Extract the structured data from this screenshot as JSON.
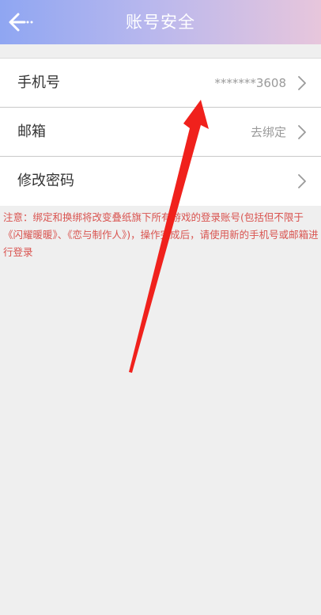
{
  "header": {
    "title": "账号安全",
    "back_icon": "arrow-left-icon"
  },
  "rows": [
    {
      "label": "手机号",
      "value": "*******3608",
      "icon": "chevron-right-icon"
    },
    {
      "label": "邮箱",
      "value": "去绑定",
      "icon": "chevron-right-icon"
    },
    {
      "label": "修改密码",
      "value": "",
      "icon": "chevron-right-icon"
    }
  ],
  "notice": "注意：绑定和换绑将改变叠纸旗下所有游戏的登录账号(包括但不限于《闪耀暖暖》、《恋与制作人》)，操作完成后，请使用新的手机号或邮箱进行登录",
  "colors": {
    "header_start": "#8fa6f2",
    "header_end": "#e7c6dc",
    "notice": "#d9534f",
    "annotation_arrow": "#f0211c",
    "background": "#efefef"
  }
}
